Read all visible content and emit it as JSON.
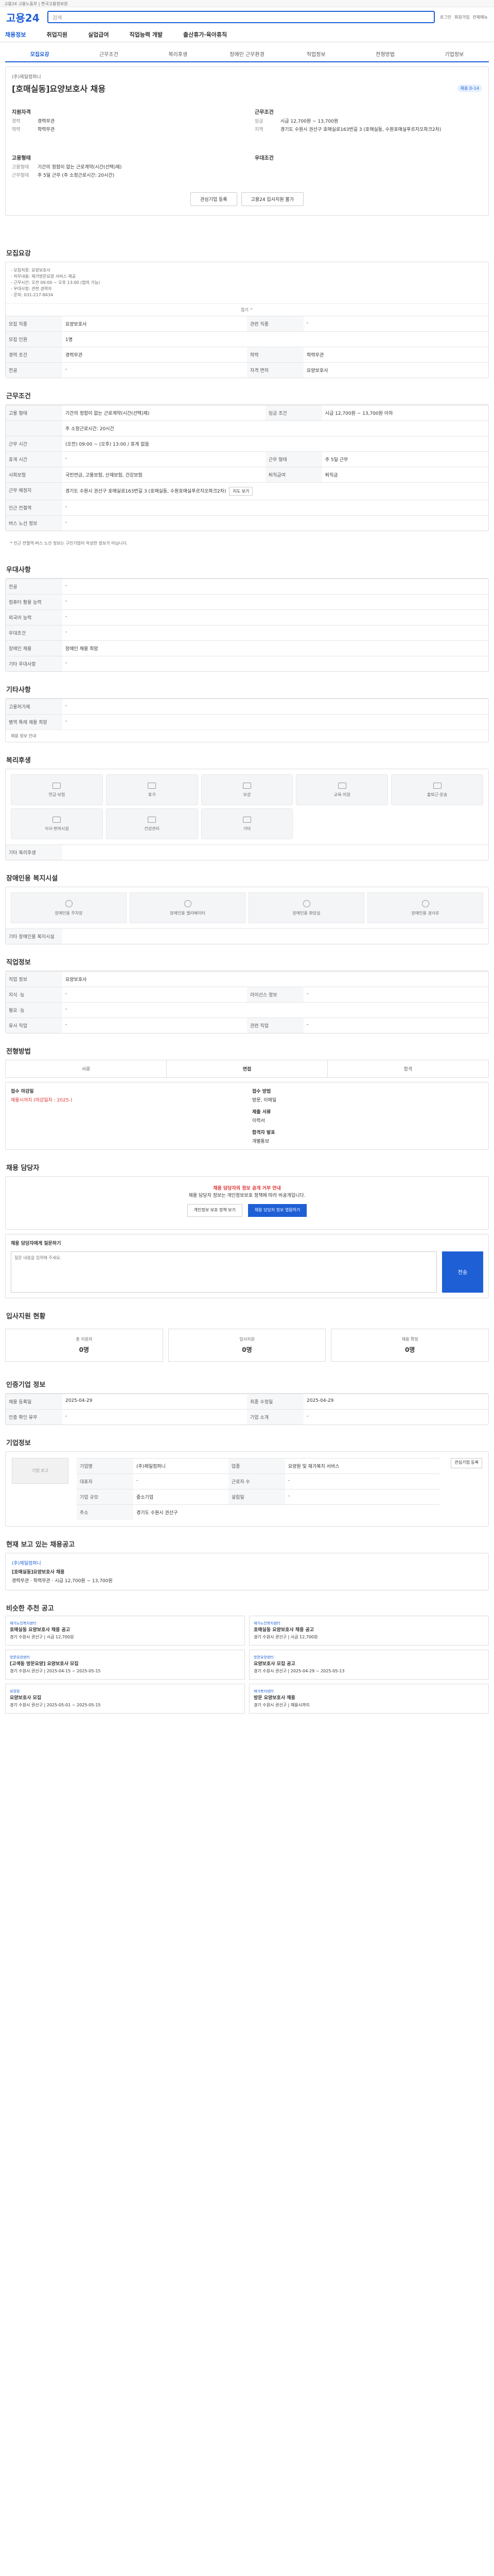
{
  "topbar": {
    "text": "고용24 고용노동부 | 한국고용정보원"
  },
  "header": {
    "logo": "고용24",
    "search_placeholder": "검색",
    "links": [
      "로그인",
      "회원가입",
      "전체메뉴"
    ]
  },
  "gnav": [
    "채용정보",
    "취업지원",
    "실업급여",
    "직업능력 개발",
    "출산휴가·육아휴직"
  ],
  "tabs": [
    "모집요강",
    "근무조건",
    "복리후생",
    "장애인 근무환경",
    "직업정보",
    "전형방법",
    "기업정보"
  ],
  "job": {
    "company": "(주)제일컴퍼니",
    "title": "[호매실동]요양보호사 채용",
    "badge": "채용 D-14",
    "qual_h": "지원자격",
    "qual": [
      [
        "경력",
        "경력무관"
      ],
      [
        "학력",
        "학력무관"
      ]
    ],
    "cond_h": "근무조건",
    "cond": [
      [
        "임금",
        "시급 12,700원 ~ 13,700원"
      ],
      [
        "지역",
        "경기도 수원시 권선구 호매실로163번길 3 (호매실동, 수원호매실푸르지오파크2차)"
      ]
    ],
    "type_h": "고용형태",
    "type": [
      [
        "고용형태",
        "기간의 정함이 없는 근로계약(시간(선택)제)"
      ],
      [
        "근무형태",
        "주 5일 근무 (주 소정근로시간: 20시간)"
      ]
    ],
    "pref_h": "우대조건",
    "pref": [],
    "buttons": [
      "관심기업 등록",
      "고용24 입사지원 불가"
    ]
  },
  "recruit": {
    "h": "모집요강",
    "desc": "- 모집직종: 요양보호사\n- 직무내용: 재가방문요양 서비스 제공\n- 근무시간: 오전 09:00 ~ 오후 13:00 (협의 가능)\n- 우대사항: 관련 경력자\n- 문의: 031-217-8434",
    "fold": "접기 ^",
    "rows": [
      [
        "모집 직종",
        "요양보호사"
      ],
      [
        "관련 직종",
        "-"
      ],
      [
        "모집 인원",
        "1명"
      ],
      [
        "경력 조건",
        "경력무관"
      ],
      [
        "학력",
        "학력무관"
      ],
      [
        "전공",
        "-"
      ],
      [
        "자격 면허",
        "요양보호사"
      ]
    ]
  },
  "work": {
    "h": "근무조건",
    "rows": [
      [
        "고용 형태",
        "기간의 정함이 없는 근로계약(시간(선택)제)",
        "임금 조건",
        "시급 12,700원 ~ 13,700원 이하"
      ],
      [
        "",
        "주 소정근로시간: 20시간",
        "",
        ""
      ],
      [
        "근무 시간",
        "(오전) 09:00 ~ (오후) 13:00 / 휴게 없음",
        "",
        ""
      ],
      [
        "휴게 시간",
        "-",
        "근무 형태",
        "주 5일 근무"
      ],
      [
        "사회보험",
        "국민연금, 고용보험, 산재보험, 건강보험",
        "퇴직급여",
        "퇴직금"
      ],
      [
        "근무 예정지",
        "경기도 수원시 권선구 호매실로163번길 3 (호매실동, 수원호매실푸르지오파크2차)",
        "",
        ""
      ],
      [
        "인근 전철역",
        "-",
        "",
        ""
      ],
      [
        "버스 노선 정보",
        "-",
        "",
        ""
      ]
    ],
    "map_btn": "지도 보기",
    "note": "* 인근 전철역·버스 노선 정보는 구인기업이 작성한 정보가 아닙니다."
  },
  "prefer": {
    "h": "우대사항",
    "rows": [
      [
        "전공",
        "-"
      ],
      [
        "컴퓨터 활용 능력",
        "-"
      ],
      [
        "외국어 능력",
        "-"
      ],
      [
        "우대조건",
        "-"
      ],
      [
        "장애인 채용",
        "장애인 채용 희망"
      ],
      [
        "기타 우대사항",
        "-"
      ]
    ]
  },
  "etc": {
    "h": "기타사항",
    "rows": [
      [
        "고용허가제",
        "-"
      ],
      [
        "병역 특례 채용 희망",
        "-"
      ]
    ],
    "link": "채용 정보 안내"
  },
  "welfare": {
    "h": "복리후생",
    "items": [
      "연금·보험",
      "휴가",
      "보상",
      "교육·지원",
      "출퇴근·운송",
      "식사·편의시설",
      "건강관리",
      "기타"
    ],
    "etc_label": "기타 복리후생"
  },
  "disabled": {
    "h": "장애인용 복지시설",
    "items": [
      "장애인용 주차장",
      "장애인용 엘리베이터",
      "장애인용 화장실",
      "장애인용 경사로"
    ],
    "etc_label": "기타 장애인용 복지시설"
  },
  "jobinfo": {
    "h": "직업정보",
    "rows": [
      [
        "직업 정보",
        "요양보호사"
      ],
      [
        "지식 ·능",
        "-",
        "라이선스 정보",
        "-"
      ],
      [
        "필요 ·능",
        "-",
        "",
        ""
      ],
      [
        "유사 직업",
        "-",
        "관련 직업",
        "-"
      ]
    ]
  },
  "process": {
    "h": "전형방법",
    "toggle": [
      "서류",
      "면접",
      "합격"
    ],
    "apply_h": "접수 마감일",
    "apply_v": "채용시까지 (마감일자 : 2025-)",
    "method_h": "접수 방법",
    "method_v": "방문, 이메일",
    "docs_h": "제출 서류",
    "docs_v": "이력서",
    "announce_h": "합격자 발표",
    "announce_v": "개별통보"
  },
  "contact": {
    "h": "채용 담당자",
    "warn": "채용 담당자의 정보 공개 거부 안내",
    "text": "채용 담당자 정보는 개인정보보호 정책에 따라 비공개입니다.",
    "buttons": [
      "개인정보 보호 정책 보기",
      "채용 담당자 정보 열람하기"
    ],
    "inq_h": "채용 담당자에게 질문하기",
    "inq_placeholder": "질문 내용을 입력해 주세요.",
    "send": "전송"
  },
  "stats": {
    "h": "입사지원 현황",
    "items": [
      [
        "총 지원자",
        "0명"
      ],
      [
        "입사지원",
        "0명"
      ],
      [
        "채용 확정",
        "0명"
      ]
    ]
  },
  "info": {
    "h": "인증기업 정보",
    "rows": [
      [
        "채용 등록일",
        "2025-04-29",
        "최종 수정일",
        "2025-04-29"
      ],
      [
        "인증 확인 유무",
        "-",
        "기업 소개",
        "-"
      ]
    ]
  },
  "company": {
    "h": "기업정보",
    "logo": "기업 로고",
    "rows": [
      [
        "기업명",
        "(주)제일컴퍼니",
        "업종",
        "요양원 및 재가복지 서비스"
      ],
      [
        "대표자",
        "-",
        "근로자 수",
        "-"
      ],
      [
        "기업 규모",
        "중소기업",
        "설립일",
        "-"
      ],
      [
        "주소",
        "경기도 수원시 권선구",
        "",
        ""
      ]
    ],
    "btn": "관심기업 등록"
  },
  "same": {
    "h": "현재 보고 있는 채용공고",
    "title": "[호매실동]요양보호사 채용",
    "company": "(주)제일컴퍼니",
    "tags": [
      "경력무관",
      "학력무관",
      "시급 12,700원 ~ 13,700원"
    ]
  },
  "recs": {
    "h": "비슷한 추천 공고",
    "items": [
      {
        "company": "재가노인복지센터",
        "title": "호매실동 요양보호사 채용 공고",
        "meta": "경기 수원시 권선구 | 시급 12,700원"
      },
      {
        "company": "재가노인복지센터",
        "title": "호매실동 요양보호사 채용 공고",
        "meta": "경기 수원시 권선구 | 시급 12,700원"
      },
      {
        "company": "방문요양센터",
        "title": "[고색동 방문요양] 요양보호사 모집",
        "meta": "경기 수원시 권선구 | 2025-04-15 ~ 2025-05-15"
      },
      {
        "company": "방문요양센터",
        "title": "요양보호사 모집 공고",
        "meta": "경기 수원시 권선구 | 2025-04-29 ~ 2025-05-13"
      },
      {
        "company": "요양원",
        "title": "요양보호사 모집",
        "meta": "경기 수원시 권선구 | 2025-05-01 ~ 2025-05-15"
      },
      {
        "company": "재가복지센터",
        "title": "방문 요양보호사 채용",
        "meta": "경기 수원시 권선구 | 채용시까지"
      }
    ]
  }
}
